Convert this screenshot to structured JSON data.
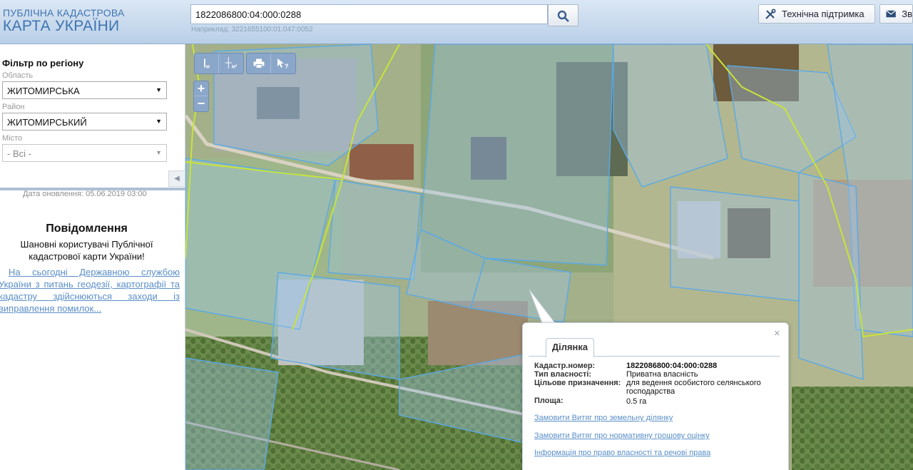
{
  "header": {
    "logo_line1": "ПУБЛІЧНА КАДАСТРОВА",
    "logo_line2": "КАРТА УКРАЇНИ",
    "search_value": "1822086800:04:000:0288",
    "search_hint": "Наприклад: 3221655100:01:047:0052",
    "support_label": "Технічна підтримка",
    "feedback_label": "Зв"
  },
  "sidebar": {
    "filter_title": "Фільтр по регіону",
    "region_label": "Область",
    "region_value": "ЖИТОМИРСЬКА",
    "district_label": "Район",
    "district_value": "ЖИТОМИРСЬКИЙ",
    "city_label": "Місто",
    "city_value": "- Всі -",
    "update_date": "Дата оновлення: 05.06.2019 03:00",
    "notice_title": "Повідомлення",
    "notice_greeting": "Шановні користувачі Публічної кадастрової карти України!",
    "notice_link": "На сьогодні Державною службою України з питань геодезії, картографії та кадастру здійснюються заходи із виправлення помилок..."
  },
  "map": {
    "tools": [
      "|м",
      "┼м²",
      "print",
      "info"
    ],
    "zoom_in": "+",
    "zoom_out": "−",
    "colors": {
      "parcel_stroke": "#5aa9e6",
      "boundary": "#c8e43a",
      "parcel_fill": "#9fc6ea"
    }
  },
  "popup": {
    "tab_label": "Ділянка",
    "close": "×",
    "fields": [
      {
        "label": "Кадастр.номер:",
        "value": "1822086800:04:000:0288"
      },
      {
        "label": "Тип власності:",
        "value": "Приватна власність"
      },
      {
        "label": "Цільове призначення:",
        "value": "для ведення особистого селянського господарства"
      },
      {
        "label": "Площа:",
        "value": "0.5 га"
      }
    ],
    "links": [
      "Замовити Витяг про земельну ділянку",
      "Замовити Витяг про нормативну грошову оцінку",
      "Інформація про право власності та речові права"
    ]
  }
}
